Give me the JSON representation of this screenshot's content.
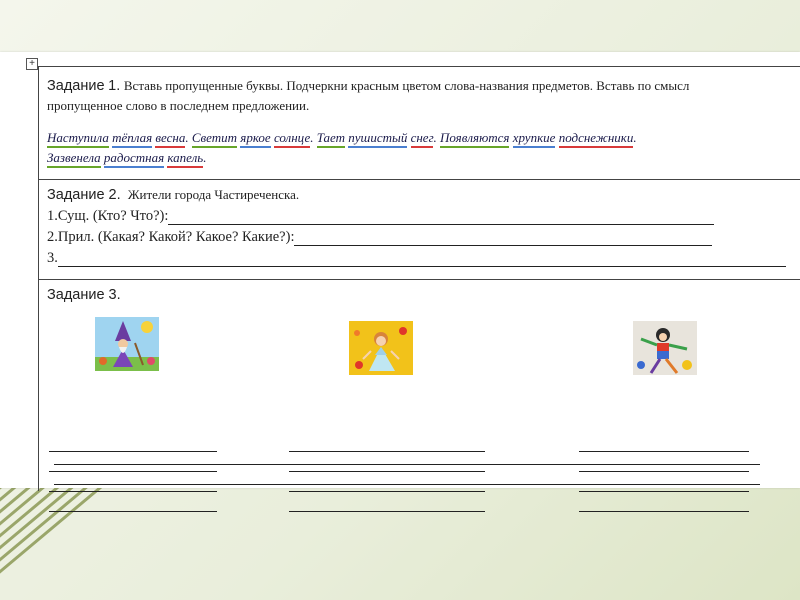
{
  "task1": {
    "heading": "Задание",
    "number": "1.",
    "instruction_line1": "Вставь пропущенные буквы. Подчеркни красным цветом слова-названия предметов. Вставь по смысл",
    "instruction_line2": "пропущенное слово в последнем предложении.",
    "sentence_line1": [
      {
        "text": "Наступила",
        "u": "green"
      },
      {
        "text": " "
      },
      {
        "text": "тёплая",
        "u": "blue"
      },
      {
        "text": " "
      },
      {
        "text": "весна",
        "u": "red"
      },
      {
        "text": ". "
      },
      {
        "text": "Светит",
        "u": "green"
      },
      {
        "text": " "
      },
      {
        "text": "яркое",
        "u": "blue"
      },
      {
        "text": " "
      },
      {
        "text": "солнце",
        "u": "red"
      },
      {
        "text": ". "
      },
      {
        "text": "Тает",
        "u": "green"
      },
      {
        "text": " "
      },
      {
        "text": "пушистый",
        "u": "blue"
      },
      {
        "text": " "
      },
      {
        "text": "снег",
        "u": "red"
      },
      {
        "text": ". "
      },
      {
        "text": "Появляются",
        "u": "green"
      },
      {
        "text": " "
      },
      {
        "text": "хрупкие",
        "u": "blue"
      },
      {
        "text": " "
      },
      {
        "text": "подснежники",
        "u": "red"
      },
      {
        "text": "."
      }
    ],
    "sentence_line2": [
      {
        "text": "Зазвенела",
        "u": "green"
      },
      {
        "text": " "
      },
      {
        "text": "радостная",
        "u": "blue"
      },
      {
        "text": " "
      },
      {
        "text": "капель",
        "u": "red"
      },
      {
        "text": "."
      }
    ]
  },
  "task2": {
    "heading": "Задание 2.",
    "subtitle": "Жители города Частиреченска.",
    "item1": "1.Сущ. (Кто? Что?):",
    "item2": "2.Прил. (Какая? Какой? Какое? Какие?):",
    "item3": "3."
  },
  "task3": {
    "heading": "Задание 3."
  },
  "colors": {
    "underline_red": "#d83a3a",
    "underline_blue": "#4a7fd0",
    "underline_green": "#67a52a"
  }
}
